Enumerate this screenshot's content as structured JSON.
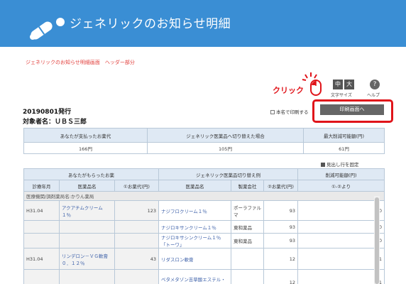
{
  "header": {
    "title": "ジェネリックのお知らせ明細"
  },
  "breadcrumb": "ジェネリックのお知らせ明細画面　ヘッダー部分",
  "toolbar": {
    "font_small": "中",
    "font_large": "大",
    "font_size_label": "文字サイズ",
    "help_glyph": "?",
    "help_label": "ヘルプ"
  },
  "annotation": {
    "click_label": "クリック",
    "color": "#e0141a"
  },
  "notice": {
    "issue_date": "20190801発行",
    "person": "対象者名：ＵＢＳ三郎",
    "print_name_label": "本名で印刷する",
    "print_button": "印刷画面へ"
  },
  "summary": {
    "headers": [
      "あなたが支払ったお薬代",
      "ジェネリック医薬品へ切り替えた場合",
      "最大削減可能額(円)"
    ],
    "values": [
      "166円",
      "105円",
      "61円"
    ]
  },
  "fix_header_label": "見出し行を固定",
  "detail": {
    "group_headers": [
      "あなたがもらったお薬",
      "ジェネリック医薬品切り替え例",
      "削減可能額(円)"
    ],
    "col_headers": [
      "診療年月",
      "医薬品名",
      "①お薬代(円)",
      "医薬品名",
      "製薬会社",
      "②お薬代(円)",
      "①-②より"
    ],
    "institution": "医療機関/調剤薬局名:かりん薬局",
    "rows": [
      {
        "ym": "H31.04",
        "drug": "アクアチムクリーム　１％",
        "cost": "123",
        "gdrug": "ナジフロクリーム１％",
        "maker": "ポーラファルマ",
        "gcost": "93",
        "saving": "30"
      },
      {
        "ym": "",
        "drug": "",
        "cost": "",
        "gdrug": "ナジロキサンクリーム１％",
        "maker": "東和薬品",
        "gcost": "93",
        "saving": "30"
      },
      {
        "ym": "",
        "drug": "",
        "cost": "",
        "gdrug": "ナジロキサシンクリーム１％「トーワ」",
        "maker": "東和薬品",
        "gcost": "93",
        "saving": "30"
      },
      {
        "ym": "H31.04",
        "drug": "リンデロン－ＶＧ軟膏０．１２％",
        "cost": "43",
        "gdrug": "リダスロン軟膏",
        "maker": "",
        "gcost": "12",
        "saving": "31"
      },
      {
        "ym": "",
        "drug": "",
        "cost": "",
        "gdrug": "ベタメタゾン吉草酸エステル・ゲンタマイシン硫酸塩軟",
        "maker": "",
        "gcost": "12",
        "saving": "31"
      }
    ]
  }
}
